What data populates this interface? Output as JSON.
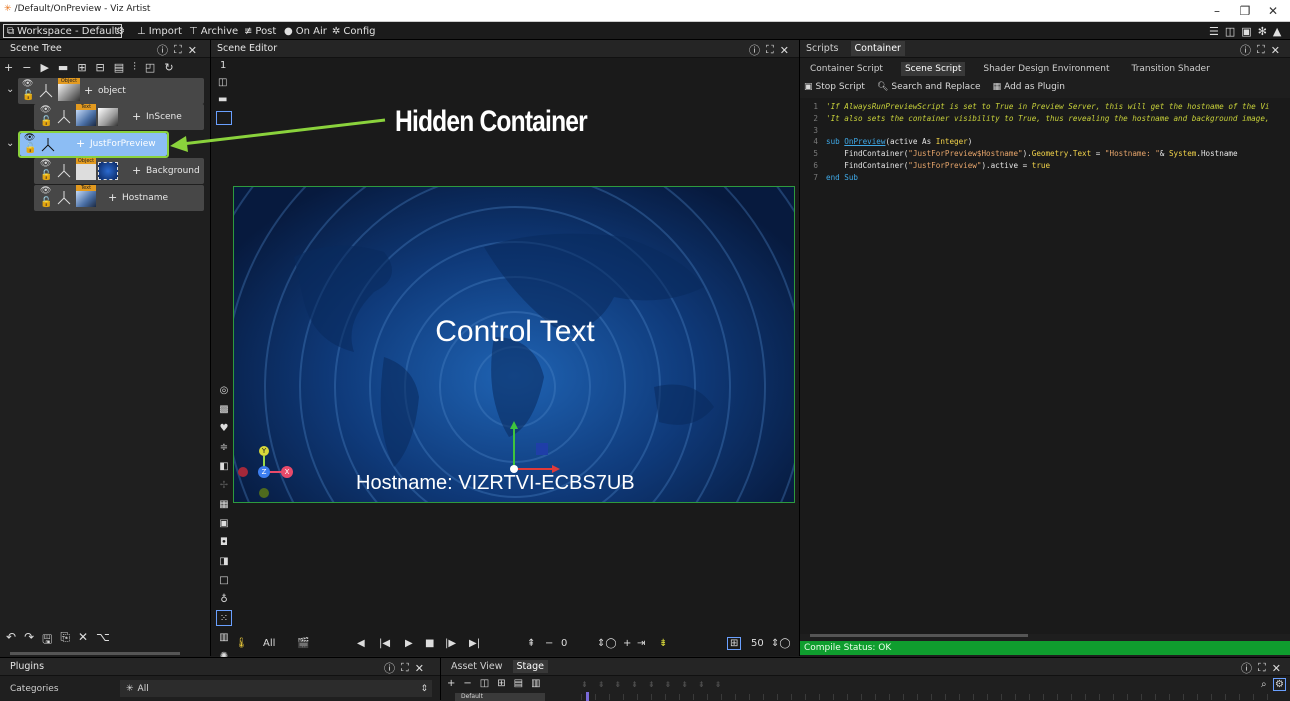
{
  "colors": {
    "accent": "#8ad23c",
    "selected": "#8cbdf4",
    "status_ok": "#0f9d2e",
    "comment": "#c8d13a",
    "keyword": "#3fa8e6",
    "string": "#e6a56b",
    "prop": "#f2d34a"
  },
  "titlebar": {
    "title": "/Default/OnPreview - Viz Artist",
    "min": "–",
    "max": "❐",
    "close": "✕"
  },
  "menubar": {
    "workspace": "Workspace - Default",
    "import": "Import",
    "archive": "Archive",
    "post": "Post",
    "onair": "On Air",
    "config": "Config"
  },
  "scene_tree": {
    "title": "Scene Tree",
    "nodes": [
      {
        "label": "object",
        "tag": "Object"
      },
      {
        "label": "InScene",
        "tag": "Text"
      },
      {
        "label": "JustForPreview",
        "tag": ""
      },
      {
        "label": "Background",
        "tag": "Object"
      },
      {
        "label": "Hostname",
        "tag": "Text"
      }
    ],
    "axis_labels": [
      "Y",
      "Z",
      "X"
    ]
  },
  "annotation": {
    "text": "Hidden Container"
  },
  "scene_editor": {
    "title": "Scene Editor",
    "layer_label": "1",
    "control_text": "Control Text",
    "hostname_text": "Hostname: VIZRTVI-ECBS7UB",
    "gizmo": {
      "y": "Y",
      "z": "Z",
      "x": "X"
    }
  },
  "transport": {
    "all_label": "All",
    "time": "0",
    "zoom": "50"
  },
  "scripts": {
    "tabs": [
      "Scripts",
      "Container"
    ],
    "subtabs": [
      "Container Script",
      "Scene Script",
      "Shader Design Environment",
      "Transition Shader"
    ],
    "active_subtab": 1,
    "toolbar": {
      "stop": "Stop Script",
      "search": "Search and Replace",
      "plugin": "Add as Plugin"
    },
    "code": [
      {
        "n": "1",
        "parts": [
          {
            "t": "'If AlwaysRunPreviewScript is set to True in Preview Server, this will get the hostname of the Vi",
            "c": "comment",
            "i": true
          }
        ]
      },
      {
        "n": "2",
        "parts": [
          {
            "t": "'It also sets the container visibility to True, thus revealing the hostname and background image,",
            "c": "comment",
            "i": true
          }
        ]
      },
      {
        "n": "3",
        "parts": []
      },
      {
        "n": "4",
        "parts": [
          {
            "t": "sub ",
            "c": "keyword"
          },
          {
            "t": "OnPreview",
            "c": "keyword",
            "u": true
          },
          {
            "t": "(active As ",
            "c": "plain"
          },
          {
            "t": "Integer",
            "c": "prop"
          },
          {
            "t": ")",
            "c": "plain"
          }
        ]
      },
      {
        "n": "5",
        "parts": [
          {
            "t": "    FindContainer(",
            "c": "plain"
          },
          {
            "t": "\"JustForPreview$Hostname\"",
            "c": "string"
          },
          {
            "t": ").",
            "c": "plain"
          },
          {
            "t": "Geometry",
            "c": "prop"
          },
          {
            "t": ".",
            "c": "plain"
          },
          {
            "t": "Text",
            "c": "prop"
          },
          {
            "t": " = ",
            "c": "plain"
          },
          {
            "t": "\"Hostname: \"",
            "c": "string"
          },
          {
            "t": "& ",
            "c": "plain"
          },
          {
            "t": "System",
            "c": "prop"
          },
          {
            "t": ".Hostname",
            "c": "plain"
          }
        ]
      },
      {
        "n": "6",
        "parts": [
          {
            "t": "    FindContainer(",
            "c": "plain"
          },
          {
            "t": "\"JustForPreview\"",
            "c": "string"
          },
          {
            "t": ").active = ",
            "c": "plain"
          },
          {
            "t": "true",
            "c": "prop"
          }
        ]
      },
      {
        "n": "7",
        "parts": [
          {
            "t": "end Sub",
            "c": "keyword"
          }
        ]
      }
    ],
    "status": "Compile Status: OK"
  },
  "plugins": {
    "title": "Plugins",
    "categories_label": "Categories",
    "all_label": "All"
  },
  "asset": {
    "tabs": [
      "Asset View",
      "Stage"
    ],
    "active_tab": 1,
    "row_label": "Default"
  }
}
